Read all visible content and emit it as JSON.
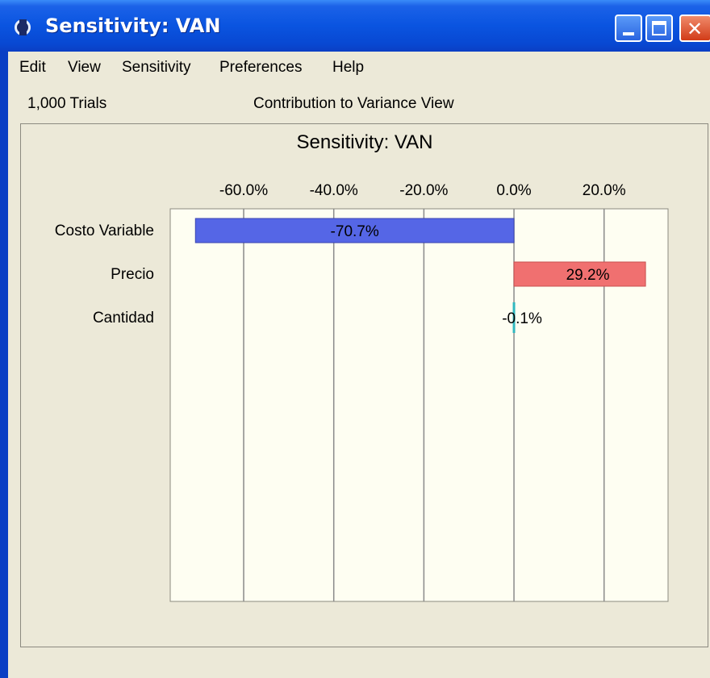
{
  "window": {
    "title": "Sensitivity: VAN"
  },
  "menu": [
    {
      "id": "edit",
      "label": "Edit"
    },
    {
      "id": "view",
      "label": "View"
    },
    {
      "id": "sensitivity",
      "label": "Sensitivity"
    },
    {
      "id": "preferences",
      "label": "Preferences"
    },
    {
      "id": "help",
      "label": "Help"
    }
  ],
  "info": {
    "trials": "1,000 Trials",
    "view_name": "Contribution to Variance View"
  },
  "colors": {
    "negative_bar": "#5566e6",
    "positive_bar": "#f07070",
    "small_bar": "#30b8c0",
    "plot_bg": "#fefef2"
  },
  "chart_data": {
    "type": "bar",
    "orientation": "horizontal",
    "title": "Sensitivity: VAN",
    "xlabel": "",
    "ylabel": "",
    "categories": [
      "Costo Variable",
      "Precio",
      "Cantidad"
    ],
    "values": [
      -70.7,
      29.2,
      -0.1
    ],
    "value_labels": [
      "-70.7%",
      "29.2%",
      "-0.1%"
    ],
    "xlim": [
      -76.3,
      34.2
    ],
    "x_ticks": [
      -60,
      -40,
      -20,
      0,
      20
    ],
    "x_tick_labels": [
      "-60.0%",
      "-40.0%",
      "-20.0%",
      "0.0%",
      "20.0%"
    ],
    "grid": true
  }
}
